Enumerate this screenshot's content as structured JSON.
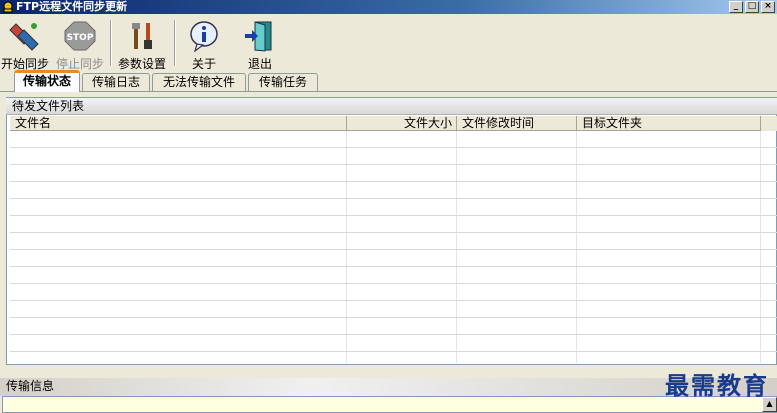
{
  "window": {
    "title": "FTP远程文件同步更新",
    "buttons": [
      "_",
      "□",
      "×"
    ]
  },
  "toolbar": {
    "start_sync": "开始同步",
    "stop_sync": "停止同步",
    "settings": "参数设置",
    "about": "关于",
    "exit": "退出"
  },
  "tabs": [
    "传输状态",
    "传输日志",
    "无法传输文件",
    "传输任务"
  ],
  "pending": {
    "caption": "待发文件列表",
    "columns": [
      "文件名",
      "文件大小",
      "文件修改时间",
      "目标文件夹"
    ]
  },
  "info": {
    "caption": "传输信息"
  },
  "watermark": "最需教育",
  "colors": {
    "title_start": "#0a246a",
    "active_tab_accent": "#e68b2c",
    "watermark": "#1a3b8c"
  }
}
